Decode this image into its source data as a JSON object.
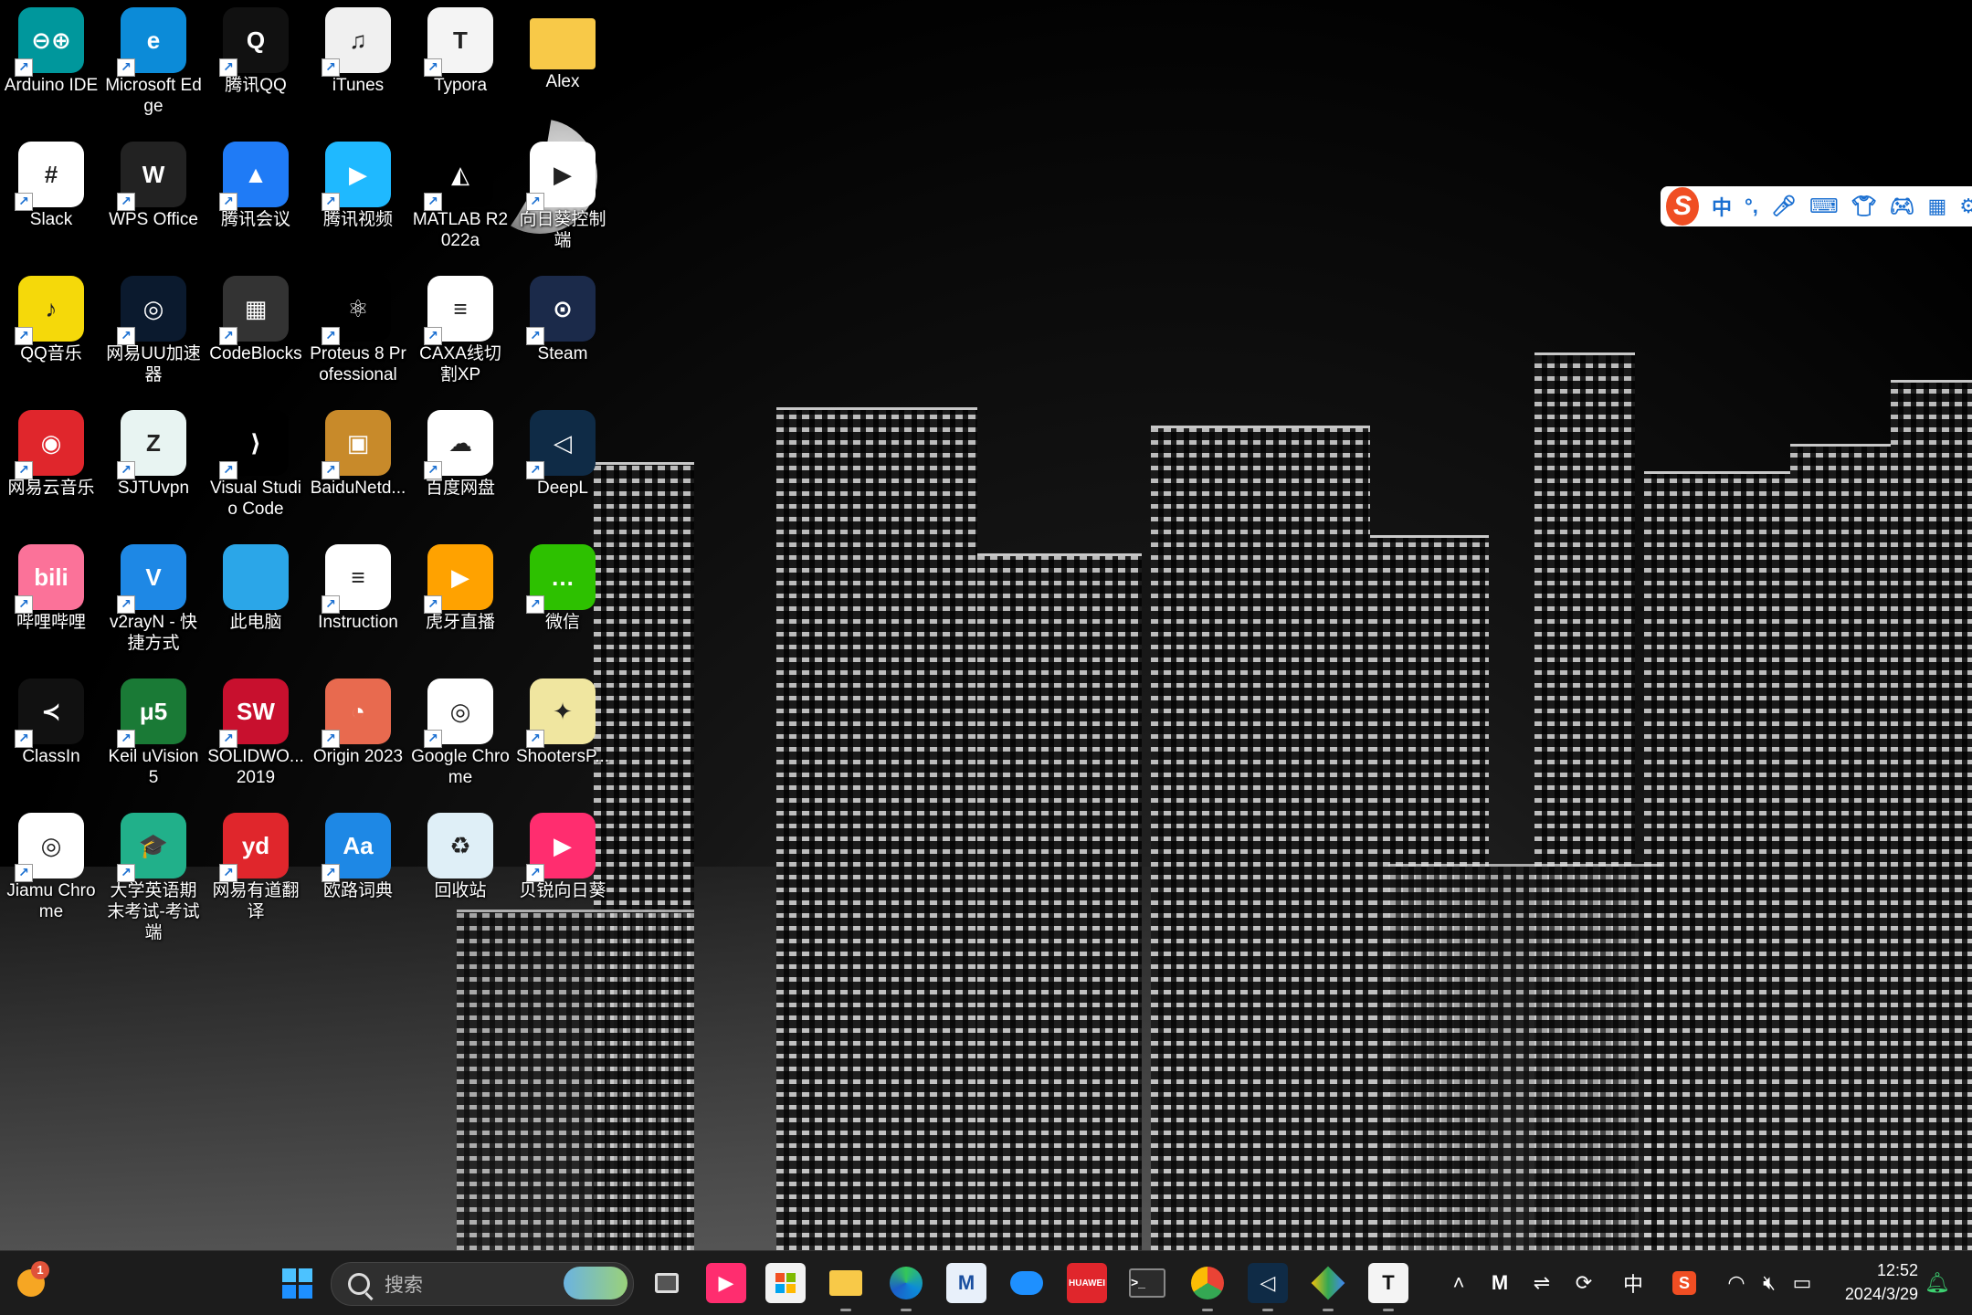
{
  "desktop": {
    "icons": [
      {
        "label": "Arduino IDE",
        "icon": "arduino-icon",
        "color": "#00979c",
        "glyph": "⊖⊕"
      },
      {
        "label": "Microsoft Edge",
        "icon": "edge-icon",
        "color": "#0c8bd8",
        "glyph": "e"
      },
      {
        "label": "腾讯QQ",
        "icon": "qq-icon",
        "color": "#111111",
        "glyph": "Q"
      },
      {
        "label": "iTunes",
        "icon": "itunes-icon",
        "color": "#f0f0f0",
        "glyph": "♫"
      },
      {
        "label": "Typora",
        "icon": "typora-icon",
        "color": "#f4f4f4",
        "glyph": "T"
      },
      {
        "label": "Alex",
        "icon": "folder-icon",
        "color": "#f8c948",
        "glyph": ""
      },
      {
        "label": "Slack",
        "icon": "slack-icon",
        "color": "#ffffff",
        "glyph": "#"
      },
      {
        "label": "WPS Office",
        "icon": "wps-icon",
        "color": "#222222",
        "glyph": "W"
      },
      {
        "label": "腾讯会议",
        "icon": "tencent-meeting-icon",
        "color": "#1f7bf6",
        "glyph": "▲"
      },
      {
        "label": "腾讯视频",
        "icon": "tencent-video-icon",
        "color": "#1fb9ff",
        "glyph": "▶"
      },
      {
        "label": "MATLAB R2022a",
        "icon": "matlab-icon",
        "color": "#000000",
        "glyph": "◭"
      },
      {
        "label": "向日葵控制端",
        "icon": "sunlogin-icon",
        "color": "#ffffff",
        "glyph": "▶"
      },
      {
        "label": "QQ音乐",
        "icon": "qq-music-icon",
        "color": "#f5d90a",
        "glyph": "♪"
      },
      {
        "label": "网易UU加速器",
        "icon": "uu-booster-icon",
        "color": "#0b1a2e",
        "glyph": "◎"
      },
      {
        "label": "CodeBlocks",
        "icon": "codeblocks-icon",
        "color": "#333333",
        "glyph": "▦"
      },
      {
        "label": "Proteus 8 Professional",
        "icon": "proteus-icon",
        "color": "#000000",
        "glyph": "⚛"
      },
      {
        "label": "CAXA线切割XP",
        "icon": "caxa-icon",
        "color": "#ffffff",
        "glyph": "≡"
      },
      {
        "label": "Steam",
        "icon": "steam-icon",
        "color": "#1b2a4a",
        "glyph": "⊙"
      },
      {
        "label": "网易云音乐",
        "icon": "netease-music-icon",
        "color": "#e0262c",
        "glyph": "◉"
      },
      {
        "label": "SJTUvpn",
        "icon": "sjtuvpn-icon",
        "color": "#e8f4f2",
        "glyph": "Z"
      },
      {
        "label": "Visual Studio Code",
        "icon": "vscode-icon",
        "color": "#000000",
        "glyph": "⟩"
      },
      {
        "label": "BaiduNetd...",
        "icon": "baidunetdisk-icon",
        "color": "#c88a2a",
        "glyph": "▣"
      },
      {
        "label": "百度网盘",
        "icon": "baidu-pan-icon",
        "color": "#ffffff",
        "glyph": "☁"
      },
      {
        "label": "DeepL",
        "icon": "deepl-icon",
        "color": "#0f2b46",
        "glyph": "◁"
      },
      {
        "label": "哔哩哔哩",
        "icon": "bilibili-icon",
        "color": "#fb7299",
        "glyph": "bili"
      },
      {
        "label": "v2rayN - 快捷方式",
        "icon": "v2rayn-icon",
        "color": "#1e88e5",
        "glyph": "V"
      },
      {
        "label": "此电脑",
        "icon": "this-pc-icon",
        "color": "#2ba6e8",
        "glyph": ""
      },
      {
        "label": "Instruction",
        "icon": "pdf-document-icon",
        "color": "#ffffff",
        "glyph": "≡"
      },
      {
        "label": "虎牙直播",
        "icon": "huya-icon",
        "color": "#ffa200",
        "glyph": "▶"
      },
      {
        "label": "微信",
        "icon": "wechat-icon",
        "color": "#2dc100",
        "glyph": "…"
      },
      {
        "label": "ClassIn",
        "icon": "classin-icon",
        "color": "#111111",
        "glyph": "≺"
      },
      {
        "label": "Keil uVision5",
        "icon": "keil-icon",
        "color": "#1a7a36",
        "glyph": "μ5"
      },
      {
        "label": "SOLIDWO... 2019",
        "icon": "solidworks-icon",
        "color": "#c8102e",
        "glyph": "SW"
      },
      {
        "label": "Origin 2023",
        "icon": "origin-icon",
        "color": "#e86a4f",
        "glyph": "◔"
      },
      {
        "label": "Google Chrome",
        "icon": "chrome-icon",
        "color": "#ffffff",
        "glyph": "◎"
      },
      {
        "label": "ShootersP...",
        "icon": "shooters-icon",
        "color": "#f0e6a0",
        "glyph": "✦"
      },
      {
        "label": "Jiamu Chrome",
        "icon": "jiamu-chrome-icon",
        "color": "#ffffff",
        "glyph": "◎"
      },
      {
        "label": "大学英语期末考试-考试端",
        "icon": "exam-client-icon",
        "color": "#21b08a",
        "glyph": "🎓"
      },
      {
        "label": "网易有道翻译",
        "icon": "youdao-icon",
        "color": "#e0262c",
        "glyph": "yd"
      },
      {
        "label": "欧路词典",
        "icon": "eudic-icon",
        "color": "#1e88e5",
        "glyph": "Aa"
      },
      {
        "label": "回收站",
        "icon": "recycle-bin-icon",
        "color": "#dfeff7",
        "glyph": "♻"
      },
      {
        "label": "贝锐向日葵",
        "icon": "oray-sunlogin-icon",
        "color": "#ff2d6f",
        "glyph": "▶"
      }
    ]
  },
  "ime_toolbar": {
    "logo": "S",
    "items": [
      "中",
      "°,",
      "mic-icon",
      "keyboard-icon",
      "skin-icon",
      "gamepad-icon",
      "apps-icon",
      "tools-icon"
    ],
    "mode": "中"
  },
  "taskbar": {
    "weather_badge": "1",
    "search_placeholder": "搜索",
    "tray": {
      "ime_mode": "中",
      "time": "12:52",
      "date": "2024/3/29"
    }
  },
  "colors": {
    "taskbar_bg": "#1c1c1c",
    "windows_blue": "#1e90ff",
    "sogou_orange": "#f04e23"
  }
}
